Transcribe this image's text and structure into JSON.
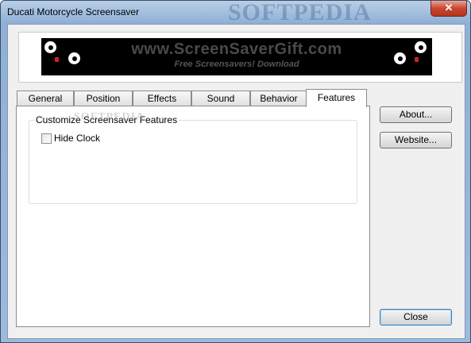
{
  "window": {
    "title": "Ducati Motorcycle Screensaver",
    "watermark": "SOFTPEDIA",
    "close_glyph": "✕"
  },
  "banner": {
    "main_text": "www.ScreenSaverGift.com",
    "sub_text": "Free Screensavers! Download"
  },
  "tabs": [
    "General",
    "Position",
    "Effects",
    "Sound",
    "Behavior",
    "Features"
  ],
  "active_tab": "Features",
  "panel": {
    "watermark": "SOFTPEDIA",
    "group_label": "Customize Screensaver Features",
    "checkbox_label": "Hide Clock",
    "checkbox_checked": false
  },
  "buttons": {
    "about": "About...",
    "website": "Website...",
    "close": "Close"
  },
  "colors": {
    "title_bar": "#9dbadd",
    "close_button": "#c9452f",
    "banner_background": "#000000"
  },
  "icons": [
    "eye-face-icon",
    "close-icon"
  ]
}
